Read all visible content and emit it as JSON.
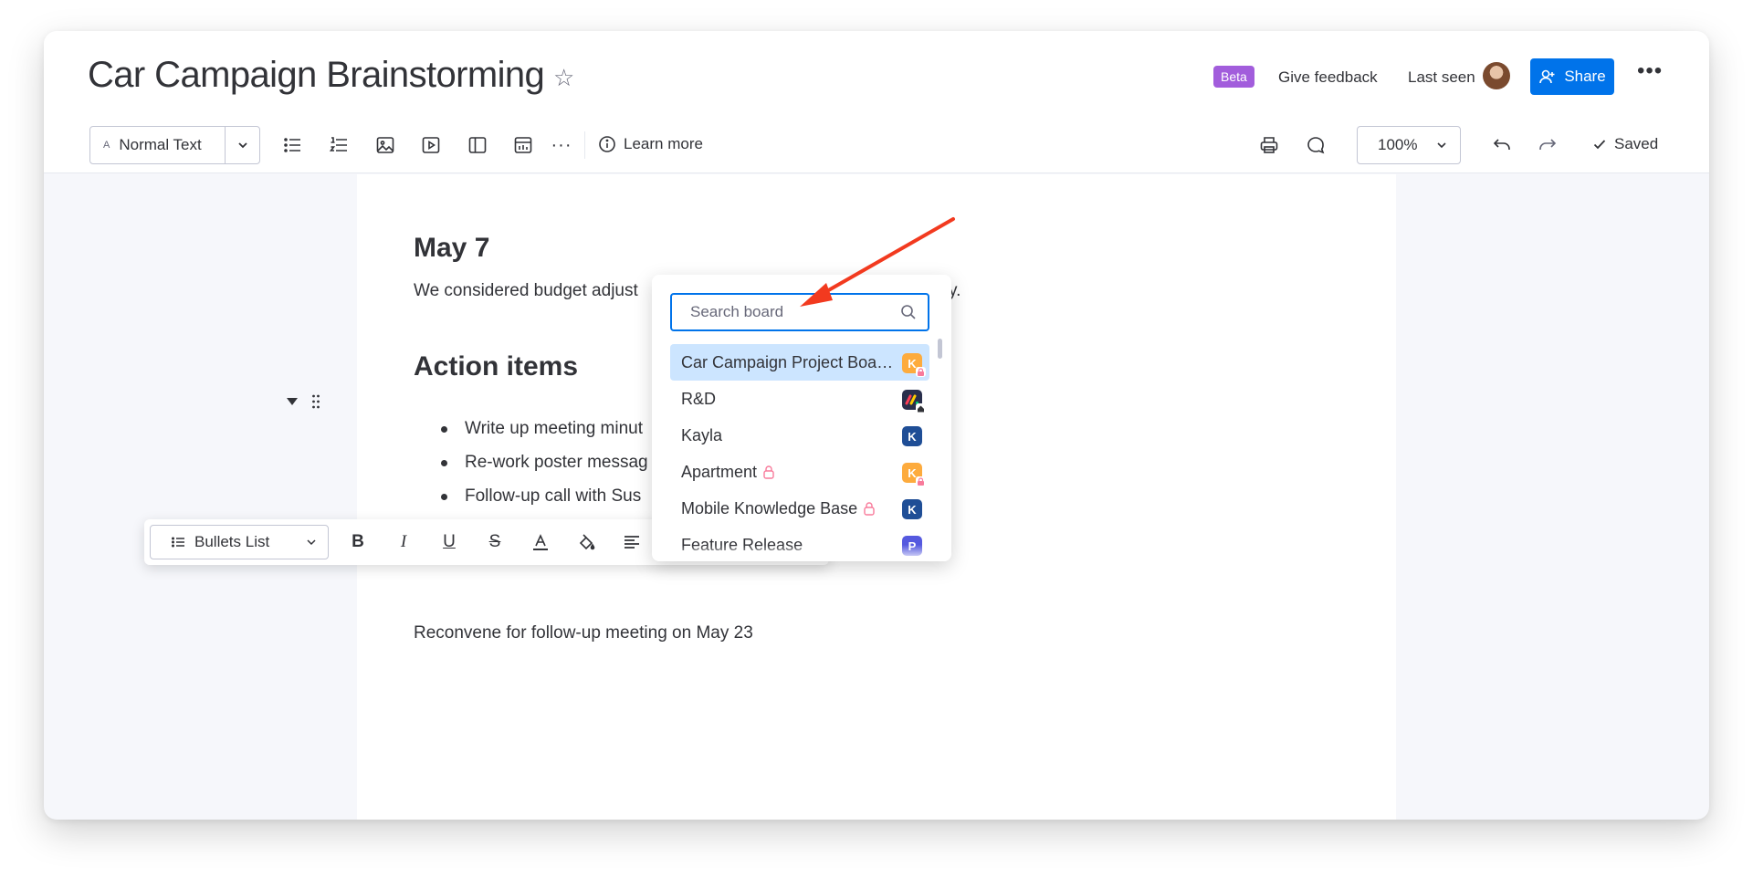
{
  "header": {
    "title": "Car Campaign Brainstorming",
    "beta_label": "Beta",
    "feedback_label": "Give feedback",
    "last_seen_label": "Last seen",
    "share_label": "Share"
  },
  "toolbar": {
    "text_style_label": "Normal Text",
    "text_style_icon": "A",
    "learn_more_label": "Learn more",
    "zoom_value": "100%",
    "saved_label": "Saved"
  },
  "document": {
    "heading_date": "May 7",
    "budget_text": "We considered budget adjust",
    "budget_tail": "y.",
    "heading_action": "Action items",
    "bullets": [
      "Write up meeting minut",
      "Re-work poster messag",
      "Follow-up call with Sus"
    ],
    "reconvene_text": "Reconvene for follow-up meeting on May 23"
  },
  "format_bar": {
    "list_type_label": "Bullets List"
  },
  "board_picker": {
    "search_placeholder": "Search board",
    "boards": [
      {
        "name": "Car Campaign Project Boa…",
        "badge": "K",
        "badge_color": "#fdab3d",
        "sub": "lock",
        "locked": false,
        "active": true
      },
      {
        "name": "R&D",
        "badge": "",
        "badge_color": "#292f4c",
        "sub": "home",
        "locked": false,
        "active": false
      },
      {
        "name": "Kayla",
        "badge": "K",
        "badge_color": "#1f4e96",
        "sub": "",
        "locked": false,
        "active": false
      },
      {
        "name": "Apartment",
        "badge": "K",
        "badge_color": "#fdab3d",
        "sub": "lock",
        "locked": true,
        "active": false
      },
      {
        "name": "Mobile Knowledge Base",
        "badge": "K",
        "badge_color": "#1f4e96",
        "sub": "",
        "locked": true,
        "active": false
      },
      {
        "name": "Feature Release",
        "badge": "P",
        "badge_color": "#5559df",
        "sub": "",
        "locked": false,
        "active": false
      }
    ]
  },
  "colors": {
    "accent": "#0073ea",
    "beta": "#a25ddc",
    "annotation_arrow": "#f23a1f"
  }
}
